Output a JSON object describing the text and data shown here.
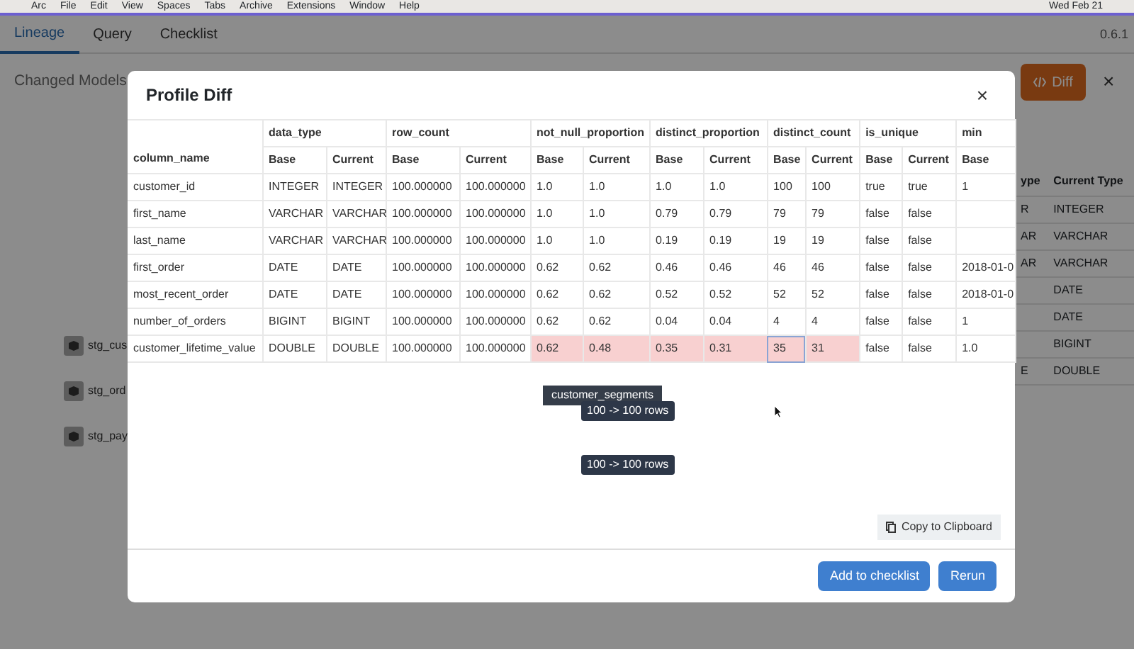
{
  "menu_bar": {
    "items": [
      "Arc",
      "File",
      "Edit",
      "View",
      "Spaces",
      "Tabs",
      "Archive",
      "Extensions",
      "Window",
      "Help"
    ],
    "clock": "Wed Feb 21"
  },
  "app": {
    "tabs": [
      {
        "label": "Lineage",
        "selected": true
      },
      {
        "label": "Query",
        "selected": false
      },
      {
        "label": "Checklist",
        "selected": false
      }
    ],
    "version": "0.6.1",
    "heading": "Changed Models",
    "diff_button": "Diff",
    "close": "×",
    "nodes": [
      "stg_cus",
      "stg_ord",
      "stg_pay"
    ],
    "side_table": {
      "columns": [
        "ype",
        "Current Type"
      ],
      "rows": [
        [
          "R",
          "INTEGER"
        ],
        [
          "AR",
          "VARCHAR"
        ],
        [
          "AR",
          "VARCHAR"
        ],
        [
          null,
          "DATE"
        ],
        [
          null,
          "DATE"
        ],
        [
          null,
          "BIGINT"
        ],
        [
          "E",
          "DOUBLE"
        ]
      ]
    }
  },
  "modal": {
    "title": "Profile Diff",
    "close": "×",
    "first_column": "column_name",
    "groups": [
      {
        "name": "data_type",
        "columns": [
          "Base",
          "Current"
        ]
      },
      {
        "name": "row_count",
        "columns": [
          "Base",
          "Current"
        ]
      },
      {
        "name": "not_null_proportion",
        "columns": [
          "Base",
          "Current"
        ]
      },
      {
        "name": "distinct_proportion",
        "columns": [
          "Base",
          "Current"
        ]
      },
      {
        "name": "distinct_count",
        "columns": [
          "Base",
          "Current"
        ]
      },
      {
        "name": "is_unique",
        "columns": [
          "Base",
          "Current"
        ]
      },
      {
        "name": "min",
        "columns": [
          "Base"
        ]
      }
    ],
    "rows": [
      {
        "cells": [
          "customer_id",
          "INTEGER",
          "INTEGER",
          "100.000000",
          "100.000000",
          "1.0",
          "1.0",
          "1.0",
          "1.0",
          "100",
          "100",
          "true",
          "true",
          "1"
        ],
        "changed": [
          false,
          false,
          false,
          false,
          false,
          false,
          false,
          false,
          false,
          false,
          false,
          false,
          false,
          false
        ],
        "selected": [
          false,
          false,
          false,
          false,
          false,
          false,
          false,
          false,
          false,
          false,
          false,
          false,
          false,
          false
        ]
      },
      {
        "cells": [
          "first_name",
          "VARCHAR",
          "VARCHAR",
          "100.000000",
          "100.000000",
          "1.0",
          "1.0",
          "0.79",
          "0.79",
          "79",
          "79",
          "false",
          "false",
          null
        ],
        "changed": [
          false,
          false,
          false,
          false,
          false,
          false,
          false,
          false,
          false,
          false,
          false,
          false,
          false,
          false
        ],
        "selected": [
          false,
          false,
          false,
          false,
          false,
          false,
          false,
          false,
          false,
          false,
          false,
          false,
          false,
          false
        ]
      },
      {
        "cells": [
          "last_name",
          "VARCHAR",
          "VARCHAR",
          "100.000000",
          "100.000000",
          "1.0",
          "1.0",
          "0.19",
          "0.19",
          "19",
          "19",
          "false",
          "false",
          null
        ],
        "changed": [
          false,
          false,
          false,
          false,
          false,
          false,
          false,
          false,
          false,
          false,
          false,
          false,
          false,
          false
        ],
        "selected": [
          false,
          false,
          false,
          false,
          false,
          false,
          false,
          false,
          false,
          false,
          false,
          false,
          false,
          false
        ]
      },
      {
        "cells": [
          "first_order",
          "DATE",
          "DATE",
          "100.000000",
          "100.000000",
          "0.62",
          "0.62",
          "0.46",
          "0.46",
          "46",
          "46",
          "false",
          "false",
          "2018-01-0"
        ],
        "changed": [
          false,
          false,
          false,
          false,
          false,
          false,
          false,
          false,
          false,
          false,
          false,
          false,
          false,
          false
        ],
        "selected": [
          false,
          false,
          false,
          false,
          false,
          false,
          false,
          false,
          false,
          false,
          false,
          false,
          false,
          false
        ]
      },
      {
        "cells": [
          "most_recent_order",
          "DATE",
          "DATE",
          "100.000000",
          "100.000000",
          "0.62",
          "0.62",
          "0.52",
          "0.52",
          "52",
          "52",
          "false",
          "false",
          "2018-01-0"
        ],
        "changed": [
          false,
          false,
          false,
          false,
          false,
          false,
          false,
          false,
          false,
          false,
          false,
          false,
          false,
          false
        ],
        "selected": [
          false,
          false,
          false,
          false,
          false,
          false,
          false,
          false,
          false,
          false,
          false,
          false,
          false,
          false
        ]
      },
      {
        "cells": [
          "number_of_orders",
          "BIGINT",
          "BIGINT",
          "100.000000",
          "100.000000",
          "0.62",
          "0.62",
          "0.04",
          "0.04",
          "4",
          "4",
          "false",
          "false",
          "1"
        ],
        "changed": [
          false,
          false,
          false,
          false,
          false,
          false,
          false,
          false,
          false,
          false,
          false,
          false,
          false,
          false
        ],
        "selected": [
          false,
          false,
          false,
          false,
          false,
          false,
          false,
          false,
          false,
          false,
          false,
          false,
          false,
          false
        ]
      },
      {
        "cells": [
          "customer_lifetime_value",
          "DOUBLE",
          "DOUBLE",
          "100.000000",
          "100.000000",
          "0.62",
          "0.48",
          "0.35",
          "0.31",
          "35",
          "31",
          "false",
          "false",
          "1.0"
        ],
        "changed": [
          false,
          false,
          false,
          false,
          false,
          true,
          true,
          true,
          true,
          true,
          true,
          false,
          false,
          false
        ],
        "selected": [
          false,
          false,
          false,
          false,
          false,
          false,
          false,
          false,
          false,
          true,
          false,
          false,
          false,
          false
        ]
      }
    ],
    "graph_labels": [
      {
        "kind": "node",
        "text": "customer_segments"
      },
      {
        "kind": "tooltip",
        "text": "100 -> 100 rows"
      },
      {
        "kind": "tooltip",
        "text": "100 -> 100 rows"
      }
    ],
    "copy_button": "Copy to Clipboard",
    "buttons": [
      "Add to checklist",
      "Rerun"
    ]
  }
}
